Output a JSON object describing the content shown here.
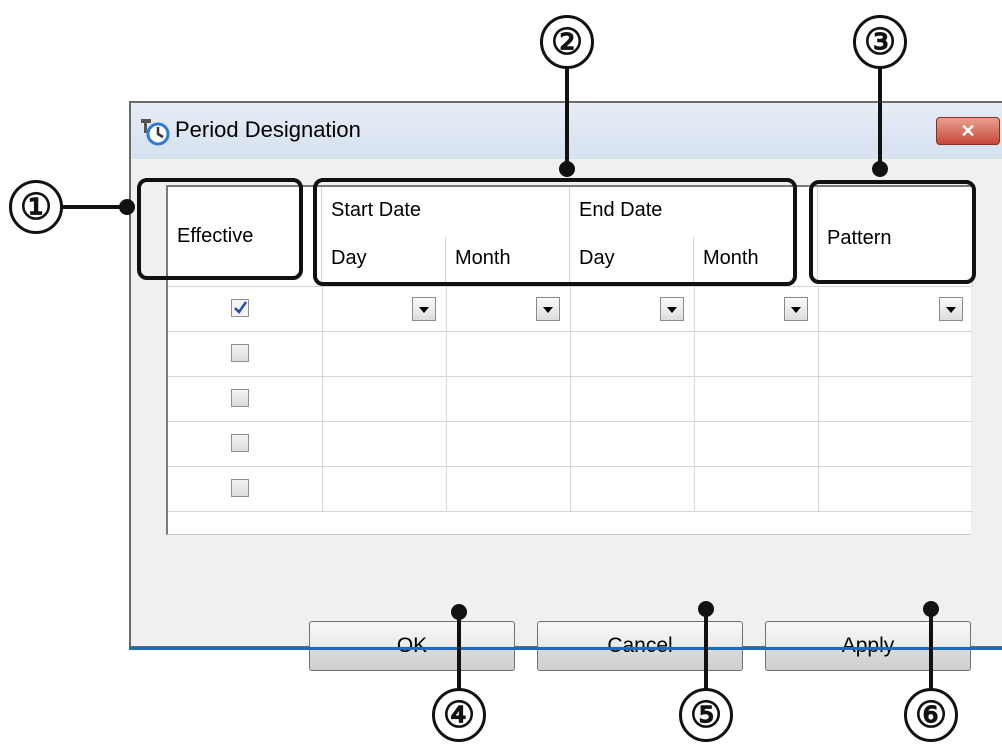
{
  "window": {
    "title": "Period Designation",
    "close_label": "✕"
  },
  "grid": {
    "header": {
      "effective": "Effective",
      "start_date": "Start Date",
      "end_date": "End Date",
      "day": "Day",
      "month": "Month",
      "pattern": "Pattern"
    },
    "rows": [
      {
        "effective_checked": true,
        "has_dropdowns": true
      },
      {
        "effective_checked": false,
        "has_dropdowns": false
      },
      {
        "effective_checked": false,
        "has_dropdowns": false
      },
      {
        "effective_checked": false,
        "has_dropdowns": false
      },
      {
        "effective_checked": false,
        "has_dropdowns": false
      }
    ]
  },
  "buttons": {
    "ok": "OK",
    "cancel": "Cancel",
    "apply": "Apply"
  },
  "callouts": {
    "c1": "①",
    "c2": "②",
    "c3": "③",
    "c4": "④",
    "c5": "⑤",
    "c6": "⑥"
  },
  "colors": {
    "close_button": "#c9483a",
    "checkmark": "#2a4fb0",
    "window_border_accent": "#1c6fb7"
  }
}
